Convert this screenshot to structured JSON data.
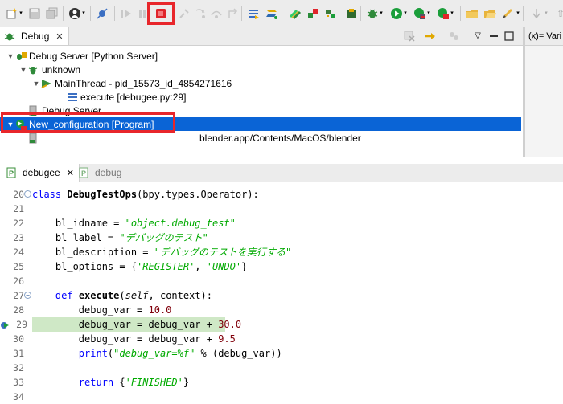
{
  "toolbar": {
    "colors": {
      "stop": "#e0242b",
      "resume": "#1a9e3a",
      "highlight": "#e8262b"
    },
    "icons": [
      "new-wizard-icon",
      "save-icon",
      "save-all-icon",
      "user-icon",
      "skip-breakpoints-icon",
      "resume-icon",
      "suspend-icon",
      "terminate-icon",
      "disconnect-icon",
      "step-into-icon",
      "step-over-icon",
      "step-return-icon",
      "drop-frame-icon",
      "use-step-filters-icon",
      "python-run-icon",
      "remote-debug-icon",
      "pydev-stop-icon",
      "pydev-start-icon",
      "debug-bug-icon",
      "run-icon",
      "coverage-icon",
      "external-tools-icon",
      "open-type-icon",
      "open-folder-icon",
      "pen-icon",
      "next-annotation-icon"
    ]
  },
  "debug_view": {
    "tab_label": "Debug",
    "close_symbol": "✕",
    "tree": [
      {
        "label": "Debug Server [Python Server]",
        "level": 0,
        "arrow": "▼",
        "icon": "debug-server-icon"
      },
      {
        "label": "unknown",
        "level": 1,
        "arrow": "▼",
        "icon": "python-process-icon"
      },
      {
        "label": "MainThread - pid_15573_id_4854271616",
        "level": 2,
        "arrow": "▼",
        "icon": "thread-icon"
      },
      {
        "label": "execute [debugee.py:29]",
        "level": 3,
        "arrow": "",
        "icon": "stack-frame-icon"
      },
      {
        "label": "Debug Server",
        "level": 1,
        "arrow": "",
        "icon": "server-icon"
      },
      {
        "label": "New_configuration [Program]",
        "level": 0,
        "arrow": "▼",
        "icon": "launch-config-icon",
        "selected": true
      },
      {
        "label": "blender.app/Contents/MacOS/blender",
        "level": 1,
        "arrow": "",
        "icon": "process-icon"
      }
    ]
  },
  "variables_view": {
    "tab_label": "(x)= Vari"
  },
  "editor": {
    "tabs": [
      {
        "label": "debugee",
        "close_symbol": "✕",
        "active": true
      },
      {
        "label": "debug",
        "active": false
      }
    ],
    "lines": [
      {
        "num": "20",
        "fold": true,
        "html": [
          [
            "kw",
            "class "
          ],
          [
            "fn",
            "DebugTestOps"
          ],
          [
            "",
            "(bpy.types.Operator):"
          ]
        ]
      },
      {
        "num": "21",
        "html": []
      },
      {
        "num": "22",
        "html": [
          [
            "",
            "    bl_idname = "
          ],
          [
            "str",
            "\"object.debug_test\""
          ]
        ]
      },
      {
        "num": "23",
        "html": [
          [
            "",
            "    bl_label = "
          ],
          [
            "str",
            "\"デバッグのテスト\""
          ]
        ]
      },
      {
        "num": "24",
        "html": [
          [
            "",
            "    bl_description = "
          ],
          [
            "str",
            "\"デバッグのテストを実行する\""
          ]
        ]
      },
      {
        "num": "25",
        "html": [
          [
            "",
            "    bl_options = {"
          ],
          [
            "str",
            "'REGISTER'"
          ],
          [
            "",
            ", "
          ],
          [
            "str",
            "'UNDO'"
          ],
          [
            "",
            "}"
          ]
        ]
      },
      {
        "num": "26",
        "html": []
      },
      {
        "num": "27",
        "fold": true,
        "html": [
          [
            "",
            "    "
          ],
          [
            "kw",
            "def "
          ],
          [
            "fn",
            "execute"
          ],
          [
            "",
            "("
          ],
          [
            "self",
            "self"
          ],
          [
            "",
            ", context):"
          ]
        ]
      },
      {
        "num": "28",
        "html": [
          [
            "",
            "        debug_var = "
          ],
          [
            "num",
            "10.0"
          ]
        ]
      },
      {
        "num": "29",
        "current": true,
        "html": [
          [
            "",
            "        debug_var = debug_var + "
          ],
          [
            "num",
            "30.0"
          ]
        ]
      },
      {
        "num": "30",
        "html": [
          [
            "",
            "        debug_var = debug_var + "
          ],
          [
            "num",
            "9.5"
          ]
        ]
      },
      {
        "num": "31",
        "html": [
          [
            "",
            "        "
          ],
          [
            "builtin",
            "print"
          ],
          [
            "",
            "("
          ],
          [
            "str",
            "\"debug_var=%f\""
          ],
          [
            "",
            " % (debug_var))"
          ]
        ]
      },
      {
        "num": "32",
        "html": []
      },
      {
        "num": "33",
        "html": [
          [
            "",
            "        "
          ],
          [
            "kw",
            "return "
          ],
          [
            "",
            "{"
          ],
          [
            "str",
            "'FINISHED'"
          ],
          [
            "",
            "}"
          ]
        ]
      },
      {
        "num": "34",
        "html": []
      }
    ]
  }
}
